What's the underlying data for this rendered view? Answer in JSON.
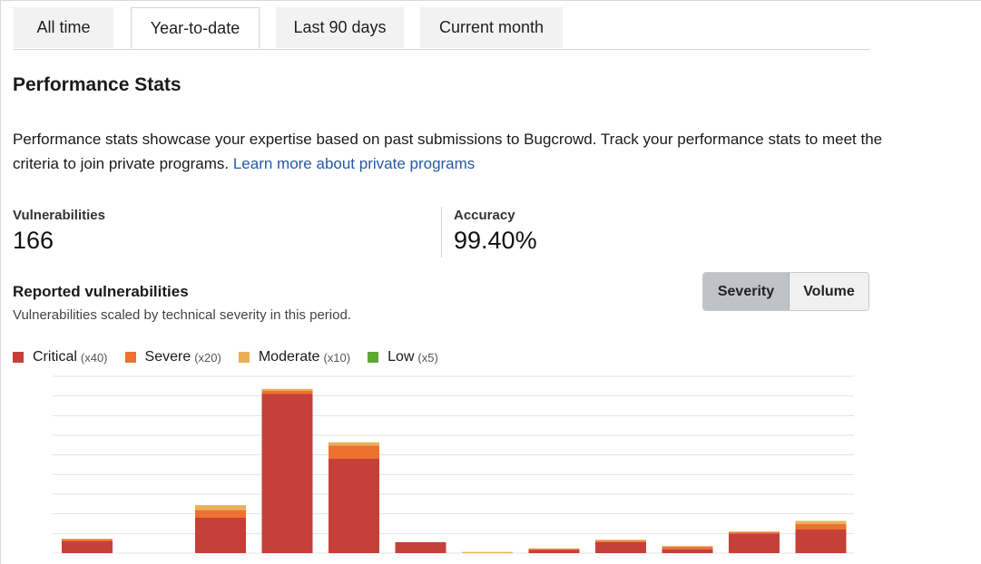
{
  "tabs": [
    {
      "label": "All time",
      "active": false
    },
    {
      "label": "Year-to-date",
      "active": true
    },
    {
      "label": "Last 90 days",
      "active": false
    },
    {
      "label": "Current month",
      "active": false
    }
  ],
  "page": {
    "title": "Performance Stats",
    "description": "Performance stats showcase your expertise based on past submissions to Bugcrowd. Track your performance stats to meet the criteria to join private programs.",
    "learn_more_link": "Learn more about private programs"
  },
  "stats": {
    "vulnerabilities": {
      "label": "Vulnerabilities",
      "value": "166"
    },
    "accuracy": {
      "label": "Accuracy",
      "value": "99.40%"
    }
  },
  "reported": {
    "title": "Reported vulnerabilities",
    "subtitle": "Vulnerabilities scaled by technical severity in this period.",
    "toggle": {
      "severity": "Severity",
      "volume": "Volume",
      "selected": "Severity"
    }
  },
  "legend": [
    {
      "label": "Critical",
      "multiplier": "(x40)",
      "color": "#c6403a"
    },
    {
      "label": "Severe",
      "multiplier": "(x20)",
      "color": "#ee7131"
    },
    {
      "label": "Moderate",
      "multiplier": "(x10)",
      "color": "#e9b05a"
    },
    {
      "label": "Low",
      "multiplier": "(x5)",
      "color": "#5ea831"
    }
  ],
  "chart_data": {
    "type": "bar",
    "stacked": true,
    "grid": true,
    "ylim": [
      0,
      450
    ],
    "series": [
      {
        "name": "Critical",
        "color": "#c6403a",
        "values": [
          30,
          0,
          90,
          405,
          240,
          28,
          0,
          8,
          28,
          10,
          50,
          60
        ]
      },
      {
        "name": "Severe",
        "color": "#ee7131",
        "values": [
          5,
          0,
          20,
          8,
          34,
          0,
          0,
          3,
          4,
          6,
          3,
          14
        ]
      },
      {
        "name": "Moderate",
        "color": "#e9b05a",
        "values": [
          2,
          0,
          12,
          5,
          8,
          0,
          3,
          1,
          2,
          2,
          2,
          8
        ]
      },
      {
        "name": "Low",
        "color": "#5ea831",
        "values": [
          0,
          0,
          0,
          0,
          0,
          0,
          0,
          0,
          0,
          0,
          0,
          0
        ]
      }
    ]
  }
}
